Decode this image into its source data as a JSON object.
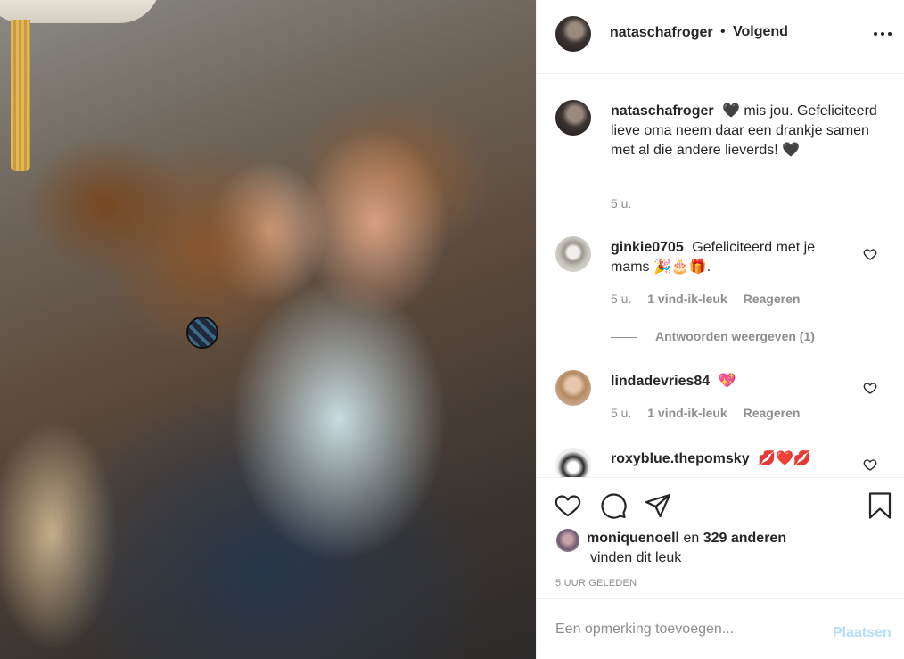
{
  "post": {
    "image_alt": "photo"
  },
  "header": {
    "username": "nataschafroger",
    "separator": "•",
    "follow_label": "Volgend"
  },
  "caption": {
    "username": "nataschafroger",
    "text": "🖤 mis jou. Gefeliciteerd lieve oma neem daar een drankje samen met al die andere lieverds! 🖤",
    "time": "5 u."
  },
  "comments": [
    {
      "username": "ginkie0705",
      "text": "Gefeliciteerd met je mams 🎉🎂🎁.",
      "time": "5 u.",
      "likes": "1 vind-ik-leuk",
      "reply": "Reageren"
    },
    {
      "username": "lindadevries84",
      "text": "💖",
      "time": "5 u.",
      "likes": "1 vind-ik-leuk",
      "reply": "Reageren"
    },
    {
      "username": "roxyblue.thepomsky",
      "text": "💋❤️💋"
    }
  ],
  "view_replies": "Antwoorden weergeven (1)",
  "likes": {
    "first_user": "moniquenoell",
    "connector": "en",
    "others": "329 anderen",
    "suffix": "vinden dit leuk"
  },
  "timestamp": "5 UUR GELEDEN",
  "add_comment": {
    "placeholder": "Een opmerking toevoegen...",
    "post_label": "Plaatsen"
  },
  "icons": {
    "more": "more-options-icon",
    "like": "heart-icon",
    "comment": "comment-icon",
    "share": "share-icon",
    "save": "bookmark-icon"
  },
  "colors": {
    "text": "#262626",
    "muted": "#8e8e8e",
    "border": "#efefef",
    "post_disabled": "#b2dffc"
  }
}
